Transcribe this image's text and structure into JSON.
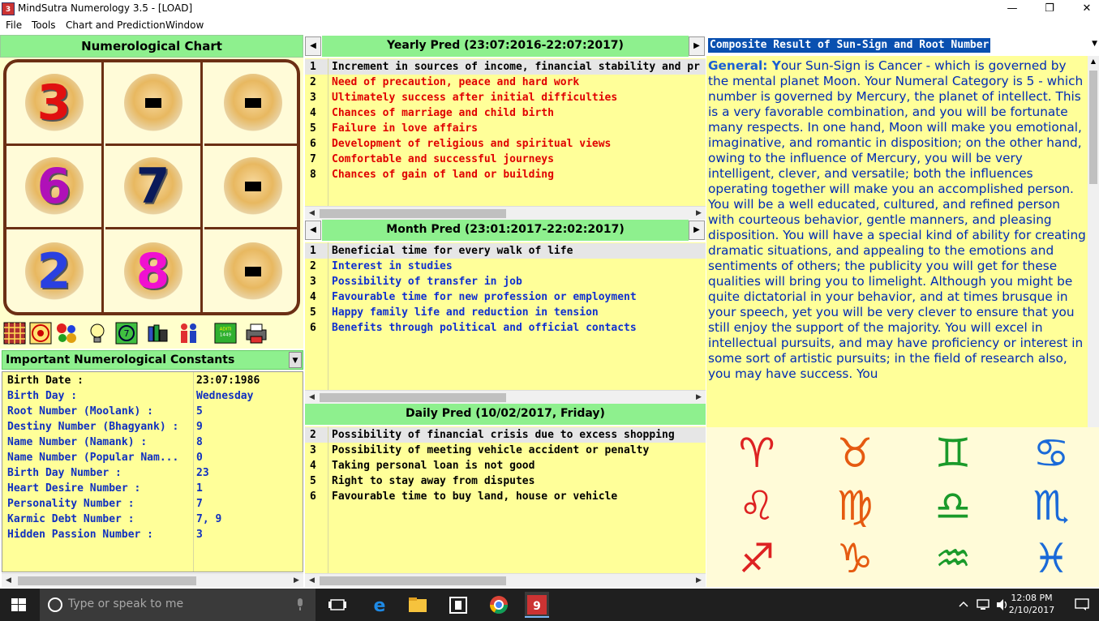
{
  "window": {
    "title": "MindSutra Numerology 3.5 - [LOAD]",
    "app_icon_text": "3",
    "minimize": "—",
    "maximize": "❐",
    "close": "✕"
  },
  "menu": [
    "File",
    "Tools",
    "Chart and Prediction",
    "Window"
  ],
  "chart": {
    "title": "Numerological Chart",
    "cells": [
      {
        "value": "3",
        "color": "#e01010"
      },
      {
        "value": "-",
        "color": "#000000"
      },
      {
        "value": "-",
        "color": "#000000"
      },
      {
        "value": "6",
        "color": "#b010b8"
      },
      {
        "value": "7",
        "color": "#0a1a5a"
      },
      {
        "value": "-",
        "color": "#000000"
      },
      {
        "value": "2",
        "color": "#2a40e0"
      },
      {
        "value": "8",
        "color": "#f010d0"
      },
      {
        "value": "-",
        "color": "#000000"
      }
    ]
  },
  "toolbar_icons": [
    "grid-icon",
    "target-icon",
    "circles-icon",
    "bulb-icon",
    "number-circle-icon",
    "books-icon",
    "people-icon",
    "aditi-icon",
    "printer-icon"
  ],
  "constants": {
    "header": "Important Numerological Constants",
    "rows": [
      {
        "label": "Birth Date :",
        "value": "23:07:1986",
        "color": "#000000"
      },
      {
        "label": "Birth Day :",
        "value": "Wednesday",
        "color": "#1030c0"
      },
      {
        "label": "Root Number (Moolank) :",
        "value": "5",
        "color": "#1030c0"
      },
      {
        "label": "Destiny Number (Bhagyank) :",
        "value": "9",
        "color": "#1030c0"
      },
      {
        "label": "Name Number (Namank) :",
        "value": "8",
        "color": "#1030c0"
      },
      {
        "label": "Name Number (Popular Nam...",
        "value": "0",
        "color": "#1030c0"
      },
      {
        "label": "Birth Day Number :",
        "value": "23",
        "color": "#1030c0"
      },
      {
        "label": "Heart Desire Number :",
        "value": "1",
        "color": "#1030c0"
      },
      {
        "label": "Personality Number :",
        "value": "7",
        "color": "#1030c0"
      },
      {
        "label": "Karmic Debt Number :",
        "value": "7, 9",
        "color": "#1030c0"
      },
      {
        "label": "Hidden Passion Number :",
        "value": "3",
        "color": "#1030c0"
      }
    ]
  },
  "yearly": {
    "title": "Yearly Pred (23:07:2016-22:07:2017)",
    "items": [
      {
        "n": "1",
        "text": "Increment in sources of income, financial stability and pr",
        "color": "#000000"
      },
      {
        "n": "2",
        "text": "Need of precaution, peace and hard work",
        "color": "#e00000"
      },
      {
        "n": "3",
        "text": "Ultimately success after initial difficulties",
        "color": "#e00000"
      },
      {
        "n": "4",
        "text": "Chances of marriage and child birth",
        "color": "#e00000"
      },
      {
        "n": "5",
        "text": "Failure in love affairs",
        "color": "#e00000"
      },
      {
        "n": "6",
        "text": "Development of religious and spiritual views",
        "color": "#e00000"
      },
      {
        "n": "7",
        "text": "Comfortable and successful journeys",
        "color": "#e00000"
      },
      {
        "n": "8",
        "text": "Chances of gain of land or building",
        "color": "#e00000"
      }
    ]
  },
  "monthly": {
    "title": "Month Pred (23:01:2017-22:02:2017)",
    "items": [
      {
        "n": "1",
        "text": "Beneficial time for every walk of life",
        "color": "#000000"
      },
      {
        "n": "2",
        "text": "Interest in studies",
        "color": "#1030d0"
      },
      {
        "n": "3",
        "text": "Possibility of transfer in job",
        "color": "#1030d0"
      },
      {
        "n": "4",
        "text": "Favourable time for new profession or employment",
        "color": "#1030d0"
      },
      {
        "n": "5",
        "text": "Happy family life and reduction in tension",
        "color": "#1030d0"
      },
      {
        "n": "6",
        "text": "Benefits through political and official contacts",
        "color": "#1030d0"
      }
    ]
  },
  "daily": {
    "title": "Daily Pred (10/02/2017, Friday)",
    "items": [
      {
        "n": "2",
        "text": "Possibility of financial crisis due to excess shopping",
        "color": "#000000"
      },
      {
        "n": "3",
        "text": "Possibility of meeting vehicle accident or penalty",
        "color": "#000000"
      },
      {
        "n": "4",
        "text": "Taking personal loan is not good",
        "color": "#000000"
      },
      {
        "n": "5",
        "text": "Right to stay away from disputes",
        "color": "#000000"
      },
      {
        "n": "6",
        "text": "Favourable time to buy land, house or vehicle",
        "color": "#000000"
      }
    ]
  },
  "composite": {
    "header": "Composite Result of Sun-Sign and Root Number",
    "general_label": "General: Y",
    "text": "our Sun-Sign is Cancer - which is governed by the mental planet Moon. Your Numeral Category is 5 - which number is governed by Mercury, the planet of intellect. This is a very favorable combination, and you will be fortunate many respects. In one hand, Moon will make you emotional, imaginative, and romantic in disposition; on the other hand, owing to the influence of Mercury, you will be very intelligent, clever, and versatile; both the influences operating together will make you an accomplished person. You will be a well educated, cultured, and refined person with courteous behavior, gentle manners, and pleasing disposition. You will have a special kind of ability for creating dramatic situations, and appealing to the emotions and sentiments of others; the publicity you will get for these qualities will bring you to limelight. Although you might be quite dictatorial in your behavior, and at times brusque in your speech, yet you will be very clever to ensure that you still enjoy the support of the majority. You will excel in intellectual pursuits, and may have proficiency or interest in some sort of artistic pursuits; in the field of research also, you may have success. You"
  },
  "zodiac_icons": [
    "aries-icon",
    "taurus-icon",
    "gemini-icon",
    "cancer-icon",
    "leo-icon",
    "virgo-icon",
    "libra-icon",
    "scorpio-icon",
    "sagittarius-icon",
    "capricorn-icon",
    "aquarius-icon",
    "pisces-icon"
  ],
  "taskbar": {
    "search_placeholder": "Type or speak to me",
    "time": "12:08 PM",
    "date": "2/10/2017"
  }
}
